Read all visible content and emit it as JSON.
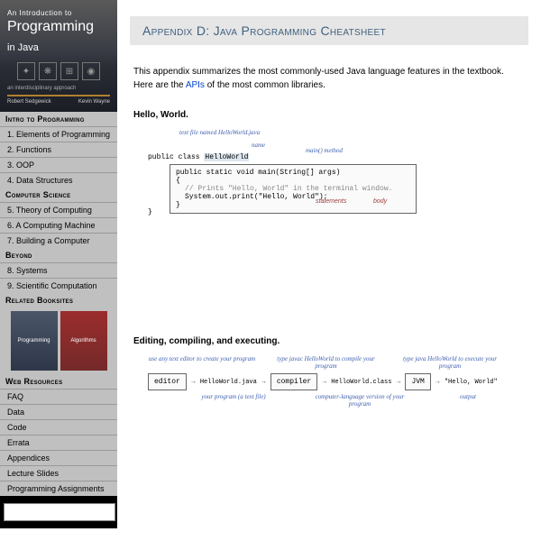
{
  "book": {
    "title_small": "An Introduction to",
    "title_big": "Programming",
    "subtitle": "in Java",
    "tagline": "an interdisciplinary approach",
    "author1": "Robert Sedgewick",
    "author2": "Kevin Wayne"
  },
  "nav": {
    "h1": "Intro to Programming",
    "i1": "1.  Elements of Programming",
    "i2": "2.  Functions",
    "i3": "3.  OOP",
    "i4": "4.  Data Structures",
    "h2": "Computer Science",
    "i5": "5.  Theory of Computing",
    "i6": "6.  A Computing Machine",
    "i7": "7.  Building a Computer",
    "h3": "Beyond",
    "i8": "8.  Systems",
    "i9": "9.  Scientific Computation",
    "h4": "Related Booksites",
    "mini1": "Programming",
    "mini2": "Algorithms",
    "h5": "Web Resources",
    "r1": "FAQ",
    "r2": "Data",
    "r3": "Code",
    "r4": "Errata",
    "r5": "Appendices",
    "r6": "Lecture Slides",
    "r7": "Programming Assignments"
  },
  "page": {
    "title": "Appendix D:   Java Programming Cheatsheet",
    "intro1": "This appendix summarizes the most commonly-used Java language features in the textbook. Here are the ",
    "intro_link": "APIs",
    "intro2": " of the most common libraries.",
    "sub1": "Hello, World.",
    "sub2": "Editing, compiling, and executing."
  },
  "hello": {
    "file": "text file named  HelloWorld.java",
    "name": "name",
    "main": "main() method",
    "outer": "public class ",
    "classname": "HelloWorld",
    "sig": "public static void main(String[] args)",
    "brace_o": "{",
    "comment": "// Prints \"Hello, World\" in the terminal window.",
    "stmt": "System.out.print(\"Hello, World\");",
    "brace_c": "}",
    "statements": "statements",
    "body": "body"
  },
  "flow": {
    "l1": "use any text editor to create your program",
    "l2": "type  javac HelloWorld to compile your program",
    "l3": "type  java HelloWorld to execute your program",
    "b1": "editor",
    "a1": "HelloWorld.java",
    "b2": "compiler",
    "a2": "HelloWorld.class",
    "b3": "JVM",
    "out": "\"Hello, World\"",
    "u1": "your program (a text file)",
    "u2": "computer-language version of your program",
    "u3": "output"
  },
  "search": {
    "placeholder": ""
  }
}
